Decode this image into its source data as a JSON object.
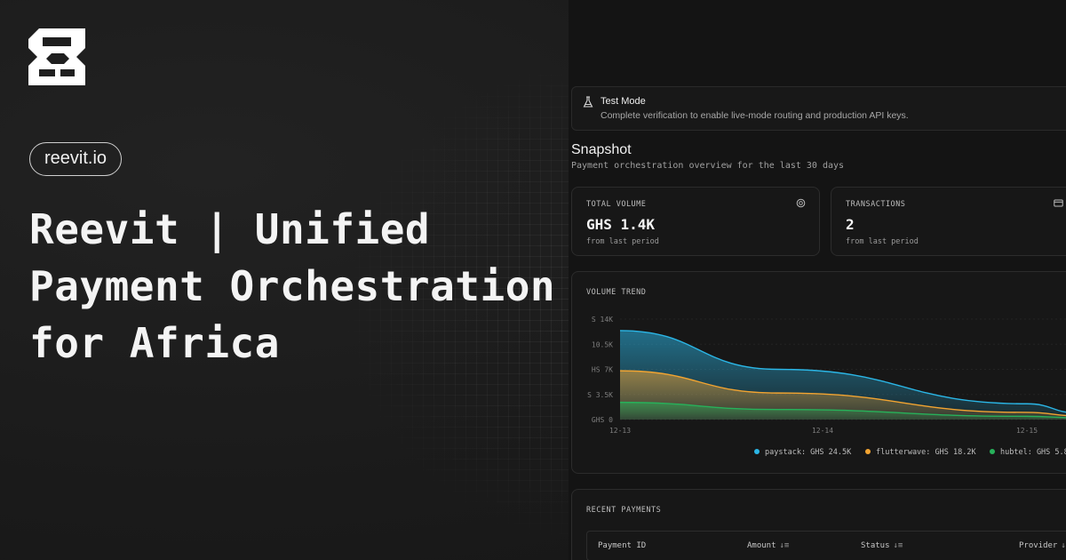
{
  "brand": {
    "domain_pill": "reevit.io",
    "headline": "Reevit | Unified Payment Orchestration for Africa"
  },
  "banner": {
    "title": "Test Mode",
    "message": "Complete verification to enable live-mode routing and production API keys.",
    "icon": "flask-icon"
  },
  "snapshot": {
    "title": "Snapshot",
    "subtitle": "Payment orchestration overview for the last 30 days"
  },
  "cards": {
    "total_volume": {
      "label": "TOTAL VOLUME",
      "value": "GHS 1.4K",
      "sub": "from last period",
      "icon": "coins-icon"
    },
    "transactions": {
      "label": "TRANSACTIONS",
      "value": "2",
      "sub": "from last period",
      "icon": "card-icon"
    }
  },
  "volume_trend": {
    "label": "VOLUME TREND",
    "colors": {
      "paystack": "#2bb6e6",
      "flutterwave": "#f2a431",
      "hubtel": "#27b15a"
    },
    "legend": [
      {
        "text": "paystack: GHS 24.5K",
        "color": "#2bb6e6"
      },
      {
        "text": "flutterwave: GHS 18.2K",
        "color": "#f2a431"
      },
      {
        "text": "hubtel: GHS 5.8",
        "color": "#27b15a"
      }
    ]
  },
  "chart_data": {
    "type": "area",
    "title": "VOLUME TREND",
    "y_tick_labels": [
      "S 14K",
      "10.5K",
      "HS 7K",
      "S 3.5K",
      "GHS 0"
    ],
    "x_tick_labels": [
      "12-13",
      "12-14",
      "12-15"
    ],
    "x": [
      "12-13",
      "12-14",
      "12-15",
      "12-15+"
    ],
    "ylim": [
      0,
      14000
    ],
    "series": [
      {
        "name": "paystack",
        "values": [
          12400,
          7000,
          2200,
          900
        ]
      },
      {
        "name": "flutterwave",
        "values": [
          6800,
          3700,
          1000,
          500
        ]
      },
      {
        "name": "hubtel",
        "values": [
          2400,
          1400,
          450,
          250
        ]
      }
    ]
  },
  "recent_payments": {
    "label": "RECENT PAYMENTS",
    "columns": [
      "Payment ID",
      "Amount",
      "Status",
      "Provider"
    ]
  }
}
